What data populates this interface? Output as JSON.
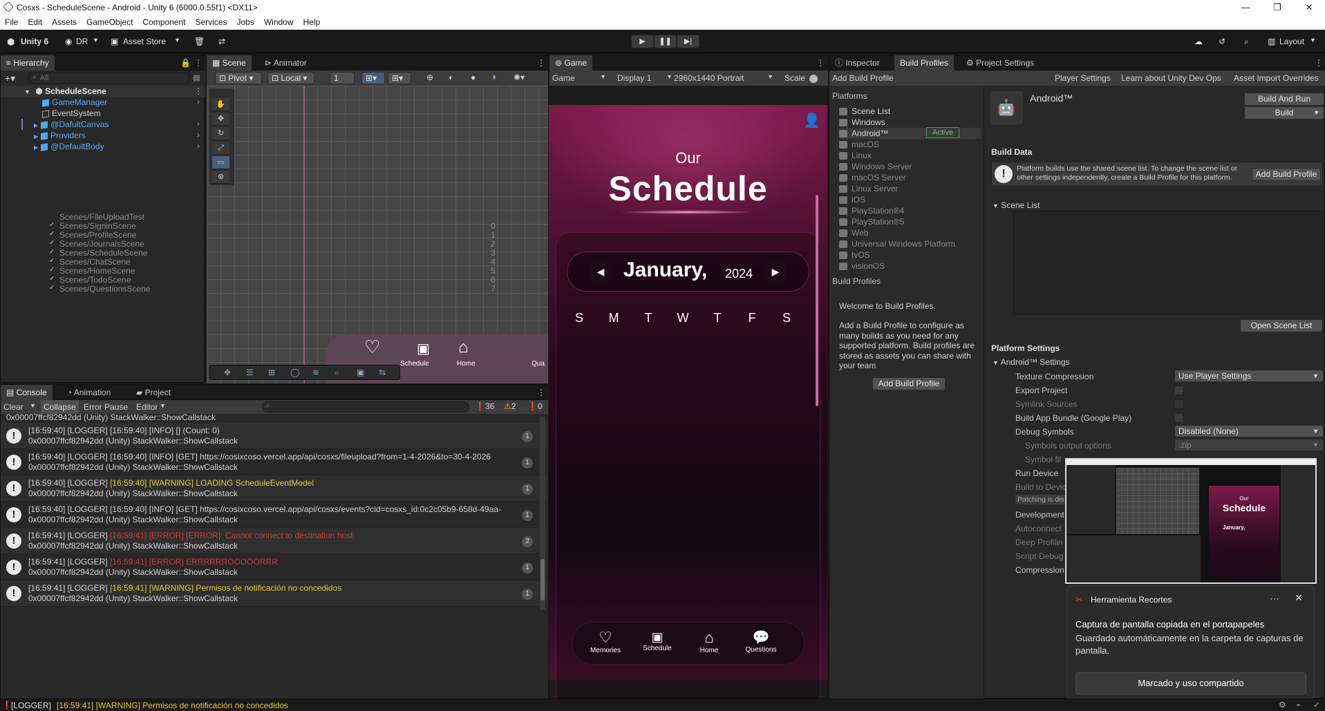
{
  "window": {
    "title": "Cosxs - ScheduleScene - Android - Unity 6 (6000.0.55f1) <DX11>",
    "controls": [
      "—",
      "❐",
      "✕"
    ]
  },
  "menu": [
    "File",
    "Edit",
    "Assets",
    "GameObject",
    "Component",
    "Services",
    "Jobs",
    "Window",
    "Help"
  ],
  "toolbar": {
    "unity": "Unity 6",
    "account": "DR",
    "asset_store": "Asset Store",
    "layout": "Layout"
  },
  "hierarchy": {
    "tab": "Hierarchy",
    "search_placeholder": "All",
    "root": "ScheduleScene",
    "items": [
      "GameManager",
      "EventSystem",
      "@DafultCanvas",
      "Providers",
      "@DefaultBody"
    ]
  },
  "scene": {
    "tabs": [
      "Scene",
      "Animator"
    ],
    "pivot": "Pivot",
    "local": "Local",
    "step": "1",
    "preview_labels": [
      "Schedule",
      "Home",
      "Qua"
    ]
  },
  "game": {
    "tab": "Game",
    "mode": "Game",
    "display": "Display 1",
    "resolution": "2960x1440 Portrait",
    "scale": "Scale"
  },
  "app": {
    "title_small": "Our",
    "title_big": "Schedule",
    "month": "January,",
    "year": "2024",
    "days": [
      "S",
      "M",
      "T",
      "W",
      "T",
      "F",
      "S"
    ],
    "nav": [
      "Memories",
      "Schedule",
      "Home",
      "Questions"
    ]
  },
  "console": {
    "tabs": [
      "Console",
      "Animation",
      "Project"
    ],
    "clear": "Clear",
    "collapse": "Collapse",
    "error_pause": "Error Pause",
    "editor": "Editor",
    "info_count": "36",
    "warn_count": "2",
    "err_count": "0",
    "top_partial": "0x00007ffcf82942dd (Unity) StackWalker::ShowCallstack",
    "rows": [
      {
        "prefix": "[16:59:40] [LOGGER] ",
        "msg": "[16:59:40] [INFO] [] (Count: 0)",
        "stack": "0x00007ffcf82942dd (Unity) StackWalker::ShowCallstack",
        "count": "1",
        "level": "info"
      },
      {
        "prefix": "[16:59:40] [LOGGER] ",
        "msg": "[16:59:40] [INFO] [GET] https://cosixcoso.vercel.app/api/cosxs/fileupload?from=1-4-2026&to=30-4-2026",
        "stack": "0x00007ffcf82942dd (Unity) StackWalker::ShowCallstack",
        "count": "1",
        "level": "info"
      },
      {
        "prefix": "[16:59:40] [LOGGER] ",
        "msg": "[16:59:40] [WARNING] LOADING ScheduleEventModel",
        "stack": "0x00007ffcf82942dd (Unity) StackWalker::ShowCallstack",
        "count": "1",
        "level": "warn"
      },
      {
        "prefix": "[16:59:40] [LOGGER] ",
        "msg": "[16:59:40] [INFO] [GET] https://cosixcoso.vercel.app/api/cosxs/events?cid=cosxs_id:0c2c05b9-658d-49aa-",
        "stack": "0x00007ffcf82942dd (Unity) StackWalker::ShowCallstack",
        "count": "1",
        "level": "info"
      },
      {
        "prefix": "[16:59:41] [LOGGER] ",
        "msg": "[16:59:41] [ERROR] [ERROR]: Cannot connect to destination host",
        "stack": "0x00007ffcf82942dd (Unity) StackWalker::ShowCallstack",
        "count": "2",
        "level": "err"
      },
      {
        "prefix": "[16:59:41] [LOGGER] ",
        "msg": "[16:59:41] [ERROR] ERRRRRROOOOORRR",
        "stack": "0x00007ffcf82942dd (Unity) StackWalker::ShowCallstack",
        "count": "1",
        "level": "err"
      },
      {
        "prefix": "[16:59:41] [LOGGER] ",
        "msg": "[16:59:41] [WARNING] Permisos de notificación no concedidos",
        "stack": "0x00007ffcf82942dd (Unity) StackWalker::ShowCallstack",
        "count": "1",
        "level": "warn"
      }
    ]
  },
  "statusbar": {
    "prefix": "[LOGGER] ",
    "msg": "[16:59:41] [WARNING] Permisos de notificación no concedidos"
  },
  "inspector_tabs": [
    "Inspector",
    "Build Profiles",
    "Project Settings"
  ],
  "build": {
    "add_build_profile": "Add Build Profile",
    "top_links": [
      "Player Settings",
      "Learn about Unity Dev Ops",
      "Asset Import Overrides"
    ],
    "platforms_header": "Platforms",
    "platforms": [
      "Scene List",
      "Windows",
      "Android™",
      "macOS",
      "Linux",
      "Windows Server",
      "macOS Server",
      "Linux Server",
      "iOS",
      "PlayStation®4",
      "PlayStation®5",
      "Web",
      "Universal Windows Platform",
      "tvOS",
      "visionOS"
    ],
    "active": "Active",
    "profiles_header": "Build Profiles",
    "welcome": "Welcome to Build Profiles.",
    "desc": "Add a Build Profile to configure as many builds as you need for any supported platform. Build profiles are stored as assets you can share with your team",
    "add_btn": "Add Build Profile",
    "platform_name": "Android™",
    "build_and_run": "Build And Run",
    "build": "Build",
    "build_data": "Build Data",
    "info": "Platform builds use the shared scene list. To change the scene list or other settings independently, create a Build Profile for this platform.",
    "info_btn": "Add Build Profile",
    "scene_list_header": "Scene List",
    "scenes": [
      {
        "name": "Scenes/FileUploadTest",
        "idx": "",
        "checked": false
      },
      {
        "name": "Scenes/SigninScene",
        "idx": "0",
        "checked": true
      },
      {
        "name": "Scenes/ProfileScene",
        "idx": "1",
        "checked": true
      },
      {
        "name": "Scenes/JournalsScene",
        "idx": "2",
        "checked": true
      },
      {
        "name": "Scenes/ScheduleScene",
        "idx": "3",
        "checked": true
      },
      {
        "name": "Scenes/ChatScene",
        "idx": "4",
        "checked": true
      },
      {
        "name": "Scenes/HomeScene",
        "idx": "5",
        "checked": true
      },
      {
        "name": "Scenes/TodoScene",
        "idx": "6",
        "checked": true
      },
      {
        "name": "Scenes/QuestionsScene",
        "idx": "7",
        "checked": true
      }
    ],
    "open_scene_list": "Open Scene List",
    "platform_settings": "Platform Settings",
    "android_settings": "Android™ Settings",
    "texture_compression": "Texture Compression",
    "texture_compression_value": "Use Player Settings",
    "export_project": "Export Project",
    "symlink_sources": "Symlink Sources",
    "build_app_bundle": "Build App Bundle (Google Play)",
    "debug_symbols": "Debug Symbols",
    "debug_symbols_value": "Disabled (None)",
    "symbols_output": "Symbols output options",
    "symbols_output_value": ".zip",
    "symbol_file": "Symbol fil",
    "run_device": "Run Device",
    "build_to_device": "Build to Devic",
    "patching": "Patching is dis",
    "development": "Development",
    "autoconnect": "Autoconnect",
    "deep_profiling": "Deep Profilin",
    "script_debug": "Script Debug",
    "compression": "Compression"
  },
  "toast": {
    "app": "Herramienta Recortes",
    "title": "Captura de pantalla copiada en el portapapeles",
    "body": "Guardado automáticamente en la carpeta de capturas de pantalla.",
    "button": "Marcado y uso compartido",
    "thumb_title_small": "Our",
    "thumb_title_big": "Schedule",
    "thumb_month": "January,"
  },
  "colors": {
    "accent": "#2c5d87",
    "warning": "#e8c63c",
    "error": "#d13a3a",
    "app_pink": "#7c1a4c",
    "active_green": "#6cc46c"
  }
}
